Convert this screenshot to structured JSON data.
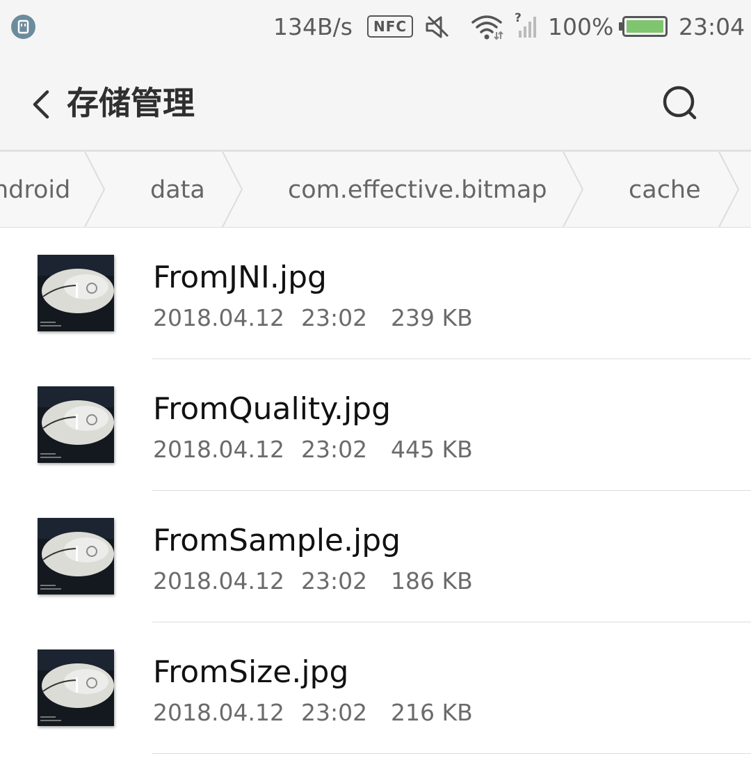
{
  "status_bar": {
    "net_speed": "134B/s",
    "nfc_label": "NFC",
    "battery_percent": "100%",
    "battery_level": 1.0,
    "time": "23:04",
    "icons": [
      "usb-debug-icon",
      "nfc-icon",
      "mute-icon",
      "wifi-icon",
      "no-sim-signal-icon",
      "battery-icon"
    ]
  },
  "app_bar": {
    "title": "存储管理",
    "icons": [
      "back-arrow-icon",
      "search-icon"
    ]
  },
  "breadcrumb": {
    "items": [
      "ndroid",
      "data",
      "com.effective.bitmap",
      "cache"
    ]
  },
  "files": [
    {
      "name": "FromJNI.jpg",
      "date": "2018.04.12",
      "time": "23:02",
      "size": "239 KB"
    },
    {
      "name": "FromQuality.jpg",
      "date": "2018.04.12",
      "time": "23:02",
      "size": "445 KB"
    },
    {
      "name": "FromSample.jpg",
      "date": "2018.04.12",
      "time": "23:02",
      "size": "186 KB"
    },
    {
      "name": "FromSize.jpg",
      "date": "2018.04.12",
      "time": "23:02",
      "size": "216 KB"
    }
  ],
  "colors": {
    "bar_background": "#f5f5f5",
    "battery_fill": "#7fc46f",
    "usb_badge": "#6c8c9d"
  }
}
